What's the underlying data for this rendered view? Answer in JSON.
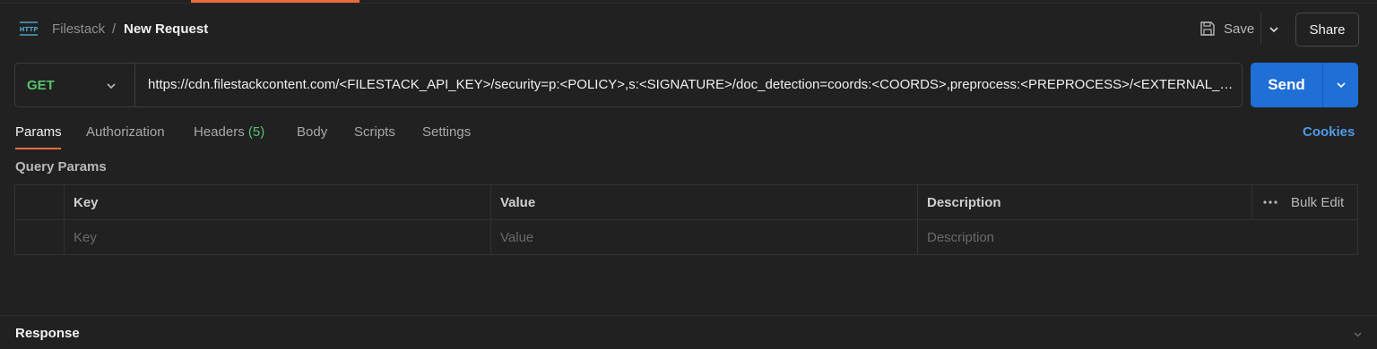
{
  "header": {
    "breadcrumb_parent": "Filestack",
    "breadcrumb_separator": "/",
    "request_name": "New Request",
    "save_label": "Save",
    "share_label": "Share",
    "http_icon": "http-icon"
  },
  "request": {
    "method": "GET",
    "url": "https://cdn.filestackcontent.com/<FILESTACK_API_KEY>/security=p:<POLICY>,s:<SIGNATURE>/doc_detection=coords:<COORDS>,preprocess:<PREPROCESS>/<EXTERNAL_URL>",
    "send_label": "Send"
  },
  "tabs": [
    {
      "label": "Params",
      "active": true
    },
    {
      "label": "Authorization"
    },
    {
      "label": "Headers",
      "count": "(5)"
    },
    {
      "label": "Body"
    },
    {
      "label": "Scripts"
    },
    {
      "label": "Settings"
    }
  ],
  "cookies_label": "Cookies",
  "query_params": {
    "title": "Query Params",
    "columns": [
      "Key",
      "Value",
      "Description"
    ],
    "bulk_edit": "Bulk Edit",
    "placeholders": {
      "key": "Key",
      "value": "Value",
      "description": "Description"
    }
  },
  "response": {
    "title": "Response"
  },
  "colors": {
    "accent_orange": "#e86c3a",
    "method_green": "#57c26d",
    "send_blue": "#1f6fd6",
    "link_blue": "#4f9bea",
    "background": "#212121"
  }
}
